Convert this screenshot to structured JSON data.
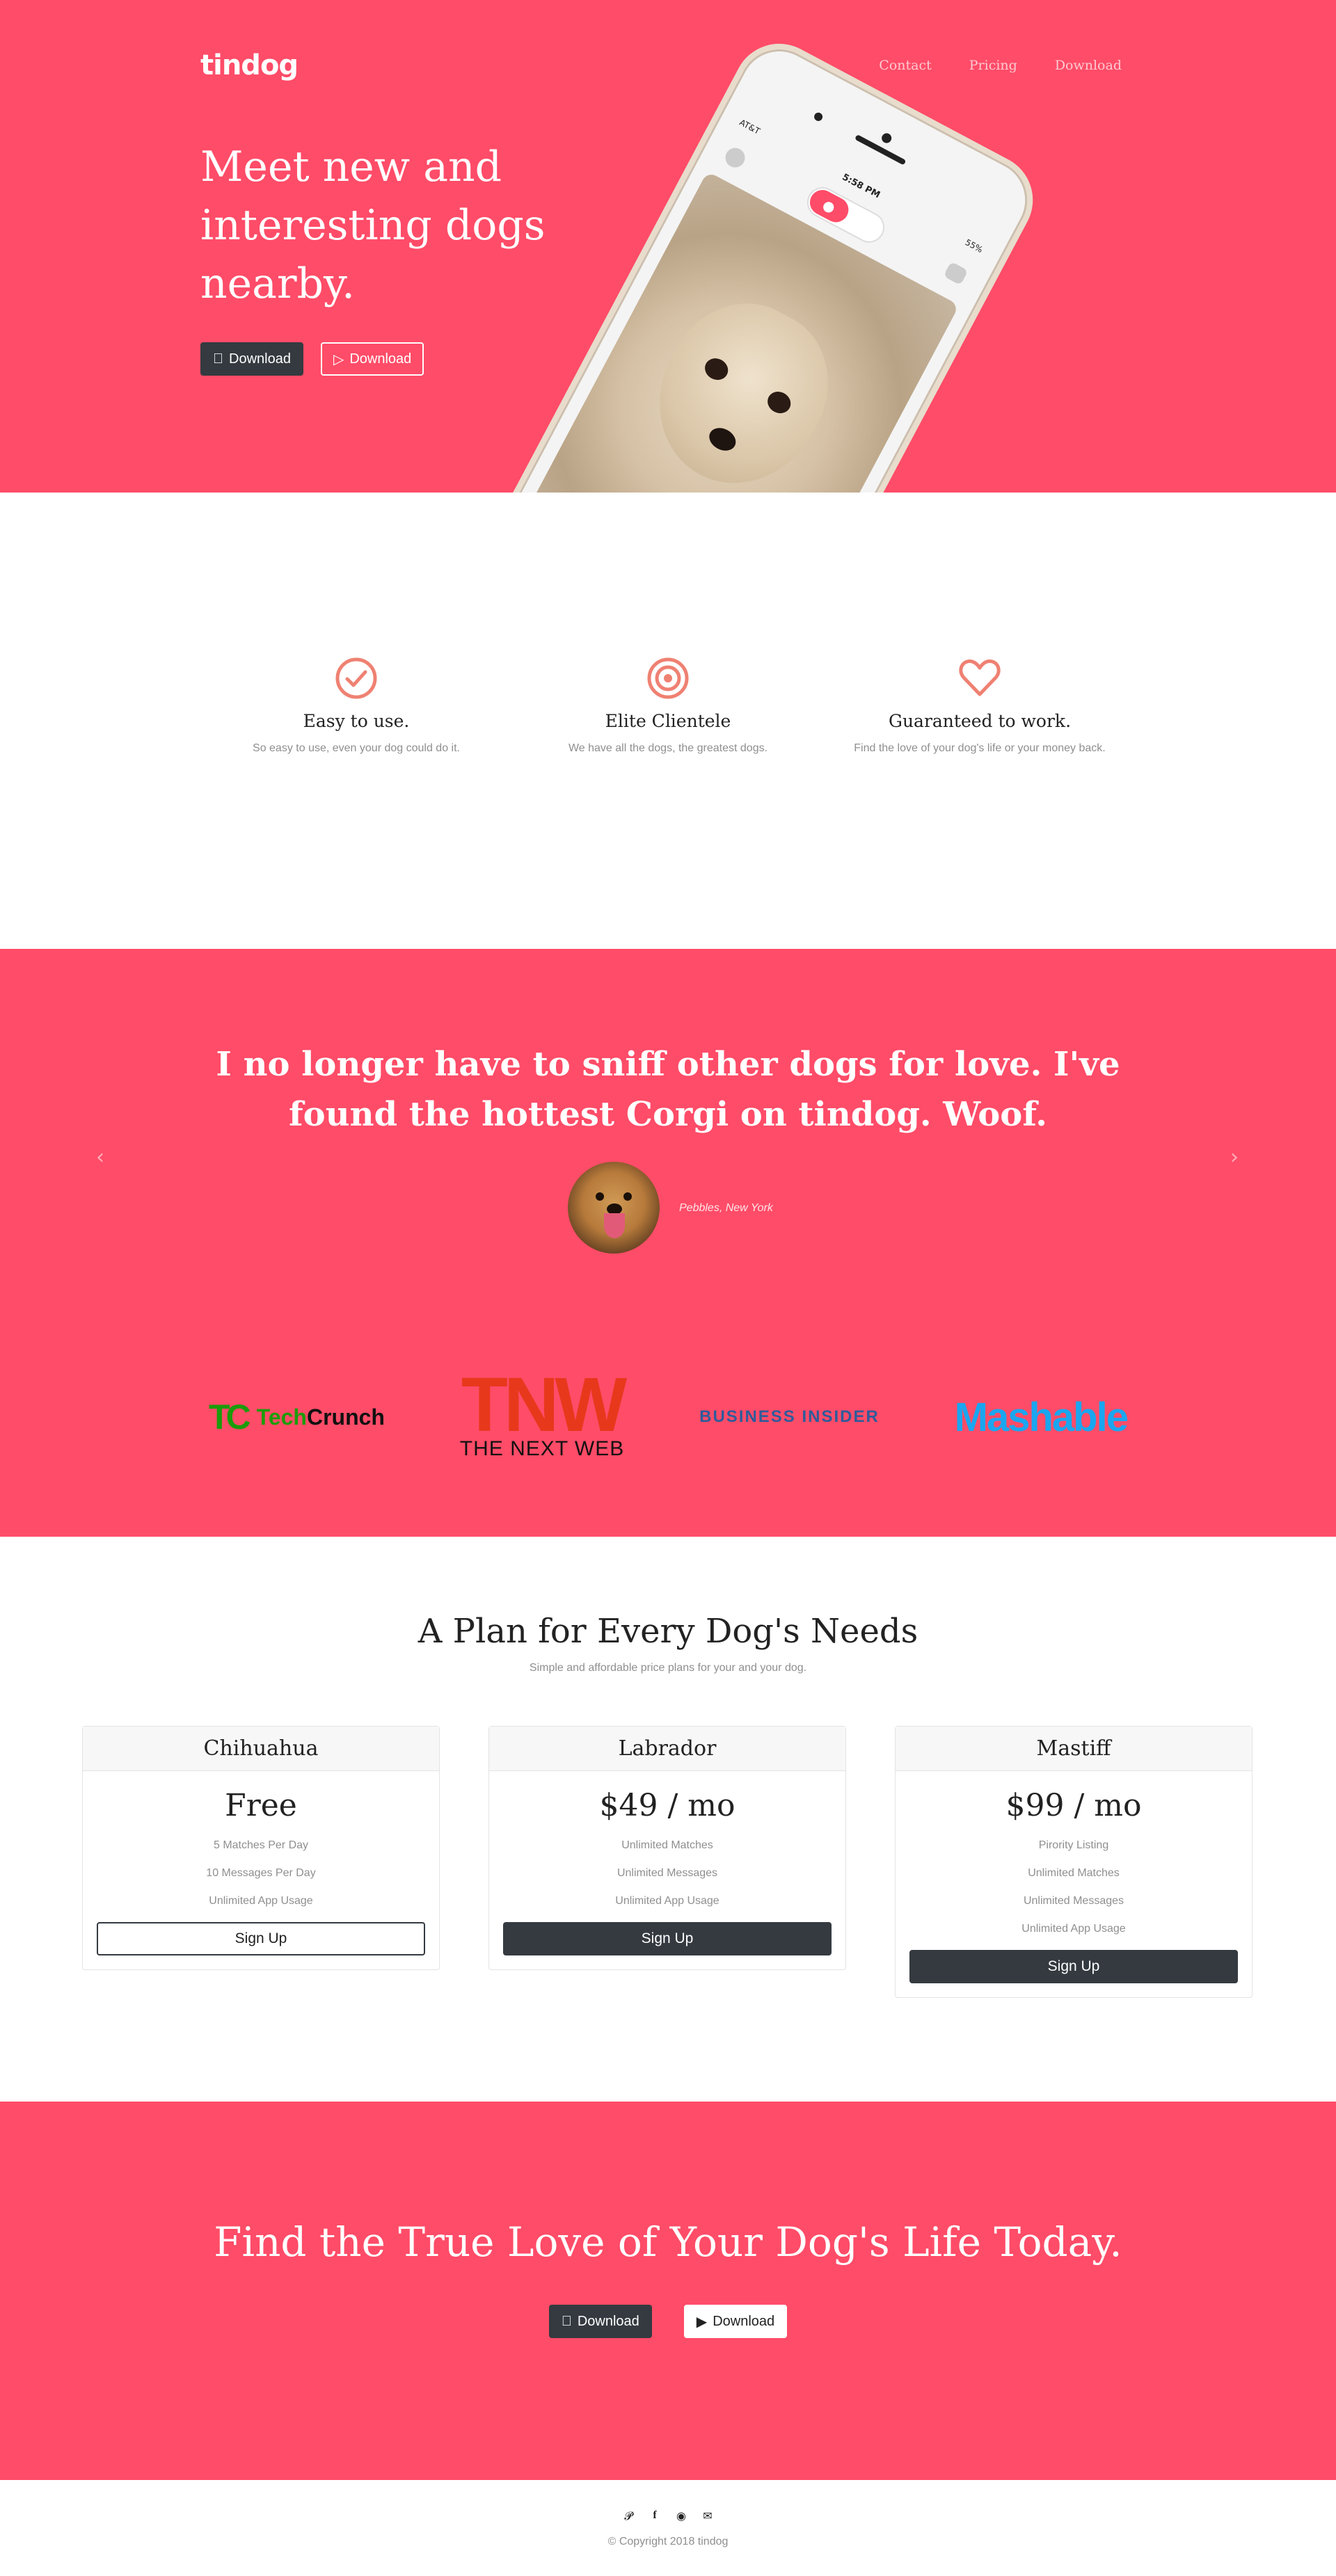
{
  "colors": {
    "brand": "#ff4c68",
    "dark": "#343a40",
    "icon": "#ef8172"
  },
  "nav": {
    "brand": "tindog",
    "links": [
      "Contact",
      "Pricing",
      "Download"
    ]
  },
  "hero": {
    "title": "Meet new and interesting dogs nearby.",
    "btn_apple": "Download",
    "btn_google": "Download",
    "phone": {
      "carrier": "AT&T",
      "time": "5:58 PM",
      "battery": "55%"
    }
  },
  "features": [
    {
      "icon": "check-circle-icon",
      "title": "Easy to use.",
      "text": "So easy to use, even your dog could do it."
    },
    {
      "icon": "bullseye-icon",
      "title": "Elite Clientele",
      "text": "We have all the dogs, the greatest dogs."
    },
    {
      "icon": "heart-icon",
      "title": "Guaranteed to work.",
      "text": "Find the love of your dog's life or your money back."
    }
  ],
  "testimonial": {
    "quote": "I no longer have to sniff other dogs for love. I've found the hottest Corgi on tindog. Woof.",
    "author": "Pebbles, New York",
    "prev_label": "‹",
    "next_label": "›"
  },
  "press": {
    "techcrunch_mark": "TC",
    "techcrunch_a": "Tech",
    "techcrunch_b": "Crunch",
    "tnw_mark": "TNW",
    "tnw_word": "THE NEXT WEB",
    "business_insider": "BUSINESS INSIDER",
    "mashable": "Mashable"
  },
  "pricing": {
    "title": "A Plan for Every Dog's Needs",
    "subtitle": "Simple and affordable price plans for your and your dog.",
    "plans": [
      {
        "name": "Chihuahua",
        "price": "Free",
        "features": [
          "5 Matches Per Day",
          "10 Messages Per Day",
          "Unlimited App Usage"
        ],
        "button": "Sign Up"
      },
      {
        "name": "Labrador",
        "price": "$49 / mo",
        "features": [
          "Unlimited Matches",
          "Unlimited Messages",
          "Unlimited App Usage"
        ],
        "button": "Sign Up"
      },
      {
        "name": "Mastiff",
        "price": "$99 / mo",
        "features": [
          "Pirority Listing",
          "Unlimited Matches",
          "Unlimited Messages",
          "Unlimited App Usage"
        ],
        "button": "Sign Up"
      }
    ]
  },
  "cta": {
    "title": "Find the True Love of Your Dog's Life Today.",
    "btn_apple": "Download",
    "btn_google": "Download"
  },
  "footer": {
    "social": [
      "twitter-icon",
      "facebook-icon",
      "instagram-icon",
      "envelope-icon"
    ],
    "copyright": "© Copyright 2018 tindog"
  }
}
